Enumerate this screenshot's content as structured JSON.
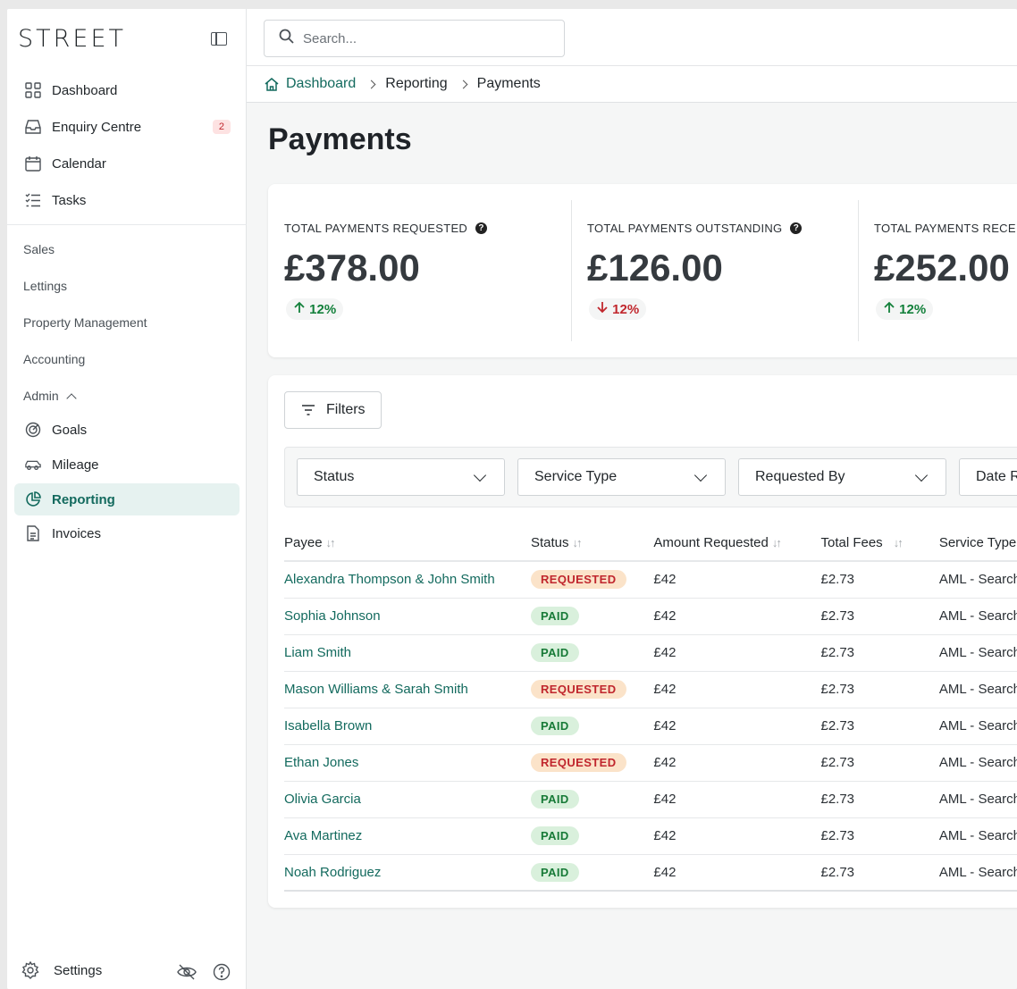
{
  "brand": "STREET",
  "sidebar": {
    "items": [
      {
        "label": "Dashboard",
        "icon": "grid-icon"
      },
      {
        "label": "Enquiry Centre",
        "icon": "inbox-icon",
        "badge": "2"
      },
      {
        "label": "Calendar",
        "icon": "calendar-icon"
      },
      {
        "label": "Tasks",
        "icon": "tasks-icon"
      }
    ],
    "sections": [
      "Sales",
      "Lettings",
      "Property Management",
      "Accounting",
      "Admin"
    ],
    "admin_items": [
      {
        "label": "Goals",
        "icon": "target-icon"
      },
      {
        "label": "Mileage",
        "icon": "car-icon"
      },
      {
        "label": "Reporting",
        "icon": "pie-chart-icon",
        "active": true
      },
      {
        "label": "Invoices",
        "icon": "document-icon"
      }
    ],
    "settings_label": "Settings"
  },
  "search": {
    "placeholder": "Search..."
  },
  "breadcrumb": {
    "home": "Dashboard",
    "level1": "Reporting",
    "level2": "Payments"
  },
  "page_title": "Payments",
  "stats": [
    {
      "label": "TOTAL PAYMENTS REQUESTED",
      "value": "£378.00",
      "change": "12%",
      "direction": "up"
    },
    {
      "label": "TOTAL PAYMENTS OUTSTANDING",
      "value": "£126.00",
      "change": "12%",
      "direction": "down"
    },
    {
      "label": "TOTAL PAYMENTS RECEIVED",
      "value": "£252.00",
      "change": "12%",
      "direction": "up"
    }
  ],
  "filters": {
    "button_label": "Filters",
    "selects": [
      "Status",
      "Service Type",
      "Requested By",
      "Date Range"
    ]
  },
  "table": {
    "columns": [
      "Payee",
      "Status",
      "Amount Requested",
      "Total Fees",
      "Service Type"
    ],
    "rows": [
      {
        "payee": "Alexandra Thompson & John Smith",
        "status": "REQUESTED",
        "amount": "£42",
        "fees": "£2.73",
        "service": "AML - Search"
      },
      {
        "payee": "Sophia Johnson",
        "status": "PAID",
        "amount": "£42",
        "fees": "£2.73",
        "service": "AML - Search"
      },
      {
        "payee": "Liam Smith",
        "status": "PAID",
        "amount": "£42",
        "fees": "£2.73",
        "service": "AML - Search"
      },
      {
        "payee": "Mason Williams & Sarah Smith",
        "status": "REQUESTED",
        "amount": "£42",
        "fees": "£2.73",
        "service": "AML - Search"
      },
      {
        "payee": "Isabella Brown",
        "status": "PAID",
        "amount": "£42",
        "fees": "£2.73",
        "service": "AML - Search"
      },
      {
        "payee": "Ethan Jones",
        "status": "REQUESTED",
        "amount": "£42",
        "fees": "£2.73",
        "service": "AML - Search"
      },
      {
        "payee": "Olivia Garcia",
        "status": "PAID",
        "amount": "£42",
        "fees": "£2.73",
        "service": "AML - Search"
      },
      {
        "payee": "Ava Martinez",
        "status": "PAID",
        "amount": "£42",
        "fees": "£2.73",
        "service": "AML - Search"
      },
      {
        "payee": "Noah Rodriguez",
        "status": "PAID",
        "amount": "£42",
        "fees": "£2.73",
        "service": "AML - Search"
      }
    ]
  },
  "colors": {
    "accent": "#136a5e",
    "active_bg": "#e6f2f0",
    "up": "#13803b",
    "down": "#c1272d"
  }
}
